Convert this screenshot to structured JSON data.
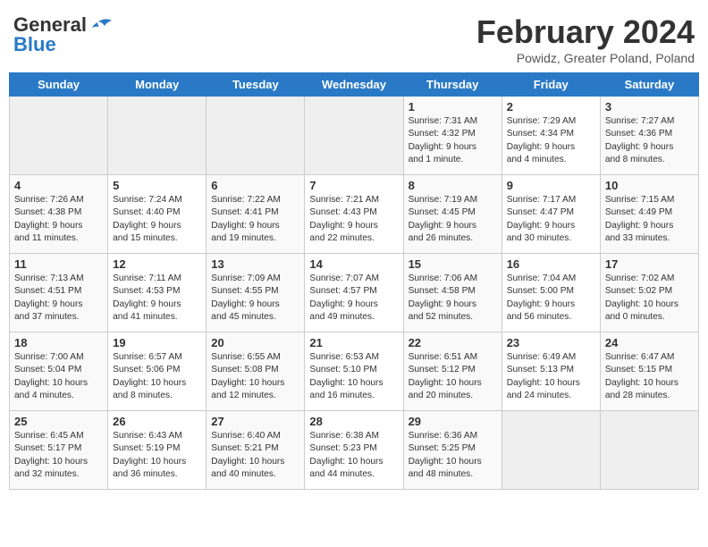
{
  "logo": {
    "line1": "General",
    "line2": "Blue"
  },
  "title": "February 2024",
  "subtitle": "Powidz, Greater Poland, Poland",
  "headers": [
    "Sunday",
    "Monday",
    "Tuesday",
    "Wednesday",
    "Thursday",
    "Friday",
    "Saturday"
  ],
  "weeks": [
    [
      {
        "day": "",
        "info": ""
      },
      {
        "day": "",
        "info": ""
      },
      {
        "day": "",
        "info": ""
      },
      {
        "day": "",
        "info": ""
      },
      {
        "day": "1",
        "info": "Sunrise: 7:31 AM\nSunset: 4:32 PM\nDaylight: 9 hours\nand 1 minute."
      },
      {
        "day": "2",
        "info": "Sunrise: 7:29 AM\nSunset: 4:34 PM\nDaylight: 9 hours\nand 4 minutes."
      },
      {
        "day": "3",
        "info": "Sunrise: 7:27 AM\nSunset: 4:36 PM\nDaylight: 9 hours\nand 8 minutes."
      }
    ],
    [
      {
        "day": "4",
        "info": "Sunrise: 7:26 AM\nSunset: 4:38 PM\nDaylight: 9 hours\nand 11 minutes."
      },
      {
        "day": "5",
        "info": "Sunrise: 7:24 AM\nSunset: 4:40 PM\nDaylight: 9 hours\nand 15 minutes."
      },
      {
        "day": "6",
        "info": "Sunrise: 7:22 AM\nSunset: 4:41 PM\nDaylight: 9 hours\nand 19 minutes."
      },
      {
        "day": "7",
        "info": "Sunrise: 7:21 AM\nSunset: 4:43 PM\nDaylight: 9 hours\nand 22 minutes."
      },
      {
        "day": "8",
        "info": "Sunrise: 7:19 AM\nSunset: 4:45 PM\nDaylight: 9 hours\nand 26 minutes."
      },
      {
        "day": "9",
        "info": "Sunrise: 7:17 AM\nSunset: 4:47 PM\nDaylight: 9 hours\nand 30 minutes."
      },
      {
        "day": "10",
        "info": "Sunrise: 7:15 AM\nSunset: 4:49 PM\nDaylight: 9 hours\nand 33 minutes."
      }
    ],
    [
      {
        "day": "11",
        "info": "Sunrise: 7:13 AM\nSunset: 4:51 PM\nDaylight: 9 hours\nand 37 minutes."
      },
      {
        "day": "12",
        "info": "Sunrise: 7:11 AM\nSunset: 4:53 PM\nDaylight: 9 hours\nand 41 minutes."
      },
      {
        "day": "13",
        "info": "Sunrise: 7:09 AM\nSunset: 4:55 PM\nDaylight: 9 hours\nand 45 minutes."
      },
      {
        "day": "14",
        "info": "Sunrise: 7:07 AM\nSunset: 4:57 PM\nDaylight: 9 hours\nand 49 minutes."
      },
      {
        "day": "15",
        "info": "Sunrise: 7:06 AM\nSunset: 4:58 PM\nDaylight: 9 hours\nand 52 minutes."
      },
      {
        "day": "16",
        "info": "Sunrise: 7:04 AM\nSunset: 5:00 PM\nDaylight: 9 hours\nand 56 minutes."
      },
      {
        "day": "17",
        "info": "Sunrise: 7:02 AM\nSunset: 5:02 PM\nDaylight: 10 hours\nand 0 minutes."
      }
    ],
    [
      {
        "day": "18",
        "info": "Sunrise: 7:00 AM\nSunset: 5:04 PM\nDaylight: 10 hours\nand 4 minutes."
      },
      {
        "day": "19",
        "info": "Sunrise: 6:57 AM\nSunset: 5:06 PM\nDaylight: 10 hours\nand 8 minutes."
      },
      {
        "day": "20",
        "info": "Sunrise: 6:55 AM\nSunset: 5:08 PM\nDaylight: 10 hours\nand 12 minutes."
      },
      {
        "day": "21",
        "info": "Sunrise: 6:53 AM\nSunset: 5:10 PM\nDaylight: 10 hours\nand 16 minutes."
      },
      {
        "day": "22",
        "info": "Sunrise: 6:51 AM\nSunset: 5:12 PM\nDaylight: 10 hours\nand 20 minutes."
      },
      {
        "day": "23",
        "info": "Sunrise: 6:49 AM\nSunset: 5:13 PM\nDaylight: 10 hours\nand 24 minutes."
      },
      {
        "day": "24",
        "info": "Sunrise: 6:47 AM\nSunset: 5:15 PM\nDaylight: 10 hours\nand 28 minutes."
      }
    ],
    [
      {
        "day": "25",
        "info": "Sunrise: 6:45 AM\nSunset: 5:17 PM\nDaylight: 10 hours\nand 32 minutes."
      },
      {
        "day": "26",
        "info": "Sunrise: 6:43 AM\nSunset: 5:19 PM\nDaylight: 10 hours\nand 36 minutes."
      },
      {
        "day": "27",
        "info": "Sunrise: 6:40 AM\nSunset: 5:21 PM\nDaylight: 10 hours\nand 40 minutes."
      },
      {
        "day": "28",
        "info": "Sunrise: 6:38 AM\nSunset: 5:23 PM\nDaylight: 10 hours\nand 44 minutes."
      },
      {
        "day": "29",
        "info": "Sunrise: 6:36 AM\nSunset: 5:25 PM\nDaylight: 10 hours\nand 48 minutes."
      },
      {
        "day": "",
        "info": ""
      },
      {
        "day": "",
        "info": ""
      }
    ]
  ]
}
